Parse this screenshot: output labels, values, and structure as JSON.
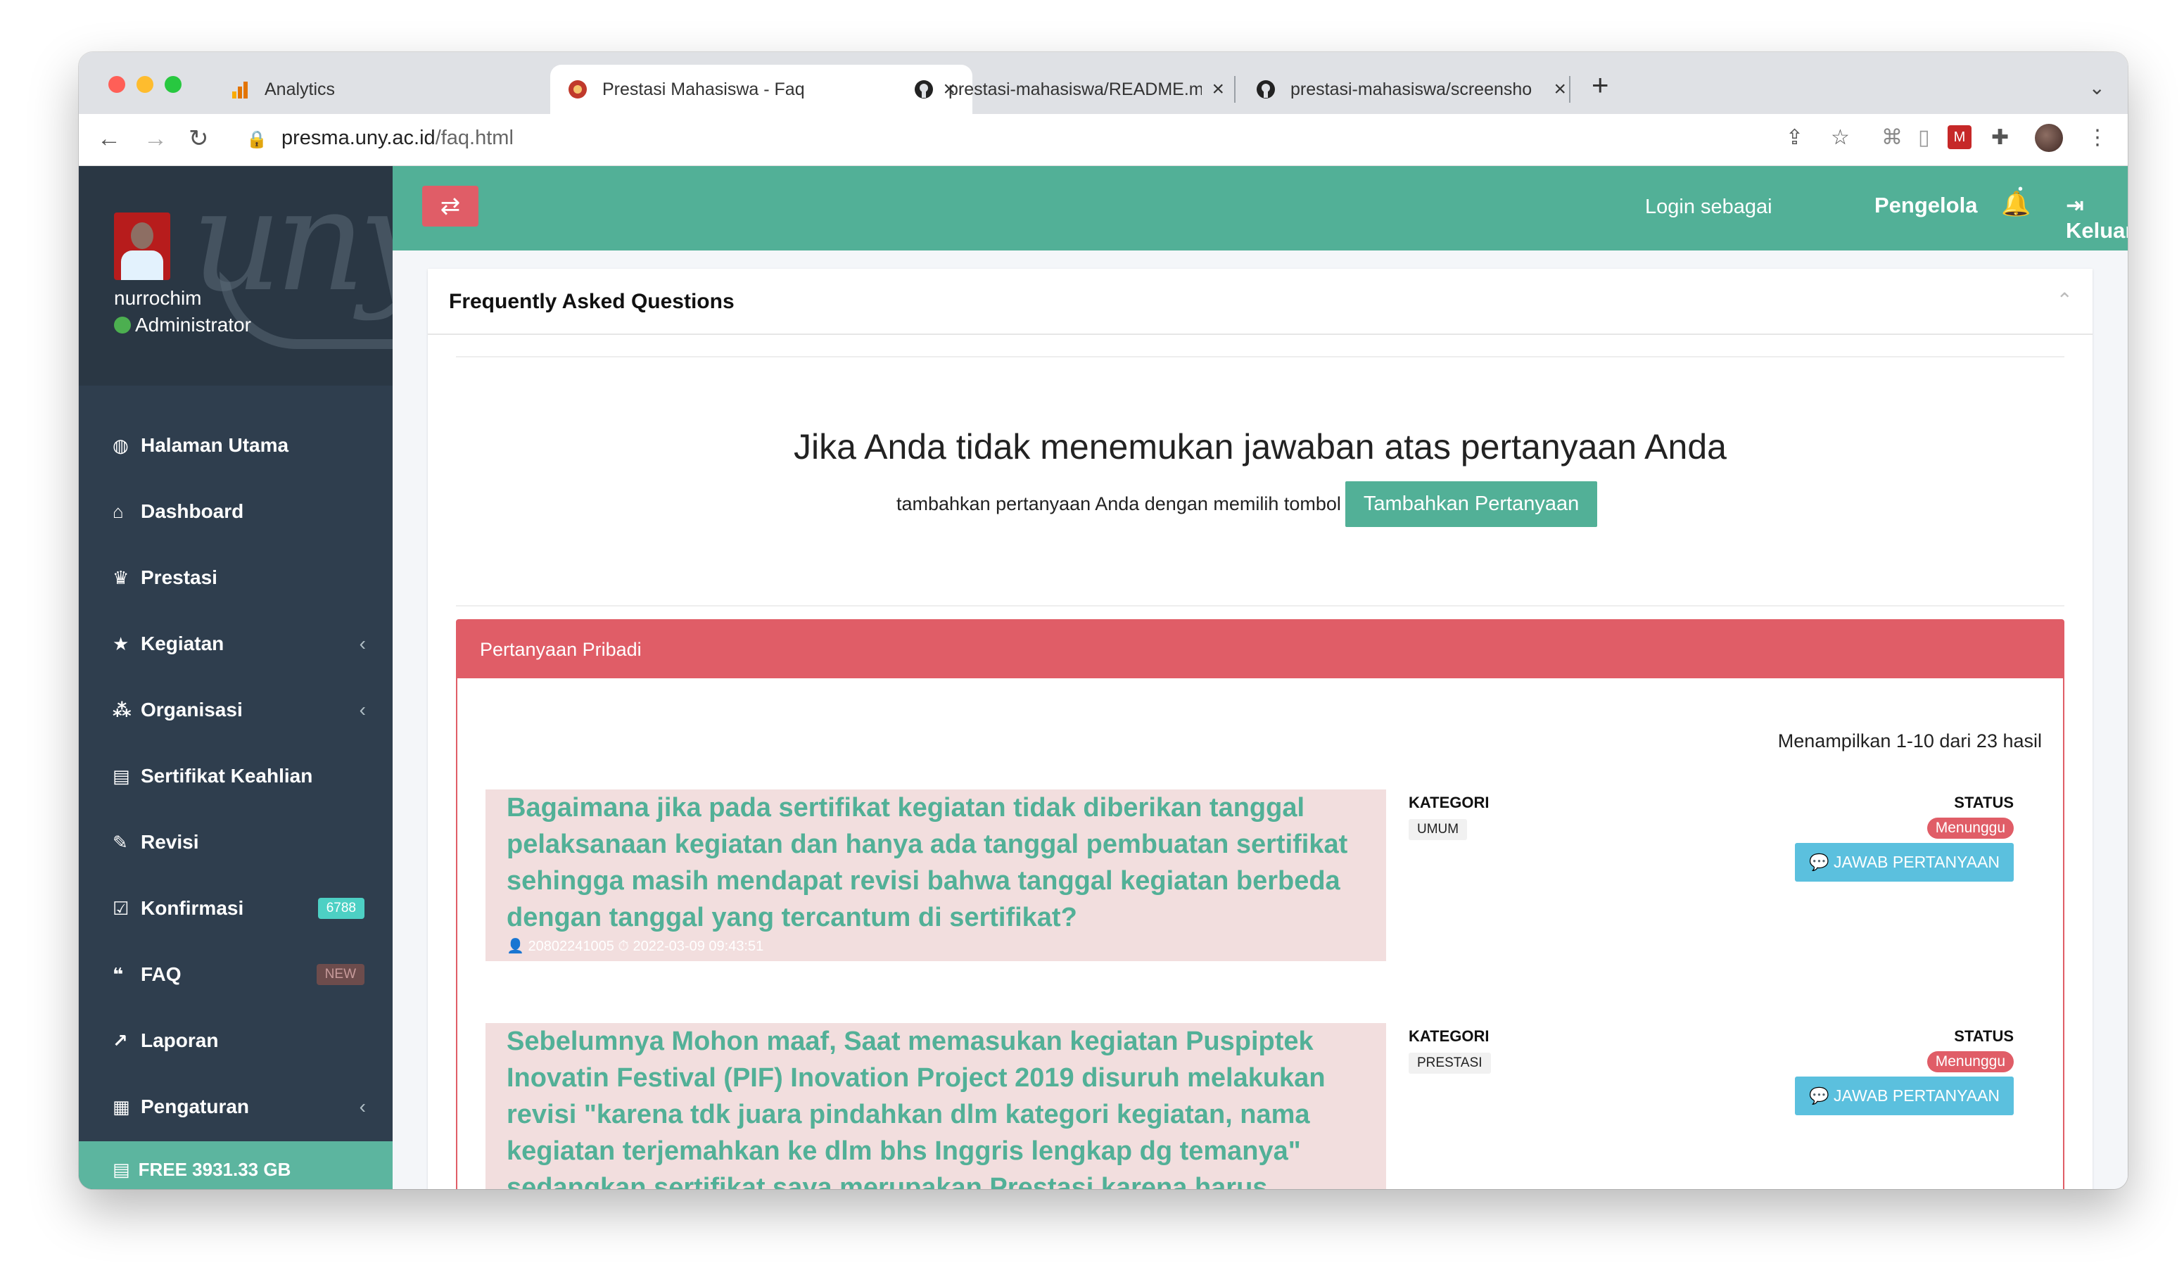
{
  "browser": {
    "tabs": [
      {
        "title": "Analytics",
        "active": false
      },
      {
        "title": "Prestasi Mahasiswa - Faq",
        "active": true
      },
      {
        "title": "prestasi-mahasiswa/README.m",
        "active": false
      },
      {
        "title": "prestasi-mahasiswa/screensho",
        "active": false
      }
    ],
    "url_host": "presma.uny.ac.id",
    "url_path": "/faq.html"
  },
  "sidebar": {
    "user_name": "nurrochim",
    "user_role": "Administrator",
    "menu": [
      {
        "label": "Halaman Utama",
        "icon": "dashboard-icon",
        "glyph": "◍"
      },
      {
        "label": "Dashboard",
        "icon": "home-icon",
        "glyph": "⌂"
      },
      {
        "label": "Prestasi",
        "icon": "trophy-icon",
        "glyph": "♛"
      },
      {
        "label": "Kegiatan",
        "icon": "star-icon",
        "glyph": "★"
      },
      {
        "label": "Organisasi",
        "icon": "sitemap-icon",
        "glyph": "⁂"
      },
      {
        "label": "Sertifikat Keahlian",
        "icon": "certificate-icon",
        "glyph": "▤"
      },
      {
        "label": "Revisi",
        "icon": "edit-icon",
        "glyph": "✎"
      },
      {
        "label": "Konfirmasi",
        "icon": "check-square-icon",
        "glyph": "☑",
        "badge": "6788"
      },
      {
        "label": "FAQ",
        "icon": "comments-icon",
        "glyph": "❝",
        "badge": "NEW"
      },
      {
        "label": "Laporan",
        "icon": "line-chart-icon",
        "glyph": "↗"
      },
      {
        "label": "Pengaturan",
        "icon": "settings-icon",
        "glyph": "▦"
      }
    ],
    "free_space": "FREE 3931.33 GB"
  },
  "topnav": {
    "login_as": "Login sebagai",
    "role": "Pengelola",
    "logout": "Keluar"
  },
  "card": {
    "title": "Frequently Asked Questions",
    "cta_title": "Jika Anda tidak menemukan jawaban atas pertanyaan Anda",
    "cta_text": "tambahkan pertanyaan Anda dengan memilih tombol",
    "cta_button": "Tambahkan Pertanyaan"
  },
  "panel": {
    "title": "Pertanyaan Pribadi",
    "result_count": "Menampilkan 1-10 dari 23 hasil",
    "questions": [
      {
        "text": "Bagaimana jika pada sertifikat kegiatan tidak diberikan tanggal pelaksanaan kegiatan dan hanya ada tanggal pembuatan sertifikat sehingga masih mendapat revisi bahwa tanggal kegiatan berbeda dengan tanggal yang tercantum di sertifikat?",
        "meta": "👤 20802241005 ⏱ 2022-03-09 09:43:51",
        "category_label": "KATEGORI",
        "category": "UMUM",
        "status_label": "STATUS",
        "status": "Menunggu",
        "answer_button": "💬 JAWAB PERTANYAAN"
      },
      {
        "text": "Sebelumnya Mohon maaf, Saat memasukan kegiatan Puspiptek Inovatin Festival (PIF) Inovation Project 2019 disuruh melakukan revisi \"karena tdk juara pindahkan dlm kategori kegiatan, nama kegiatan terjemahkan ke dlm bhs Inggris lengkap dg temanya\" sedangkan sertifikat saya merupakan Prestasi karena harus",
        "meta": "",
        "category_label": "KATEGORI",
        "category": "PRESTASI",
        "status_label": "STATUS",
        "status": "Menunggu",
        "answer_button": "💬 JAWAB PERTANYAAN"
      }
    ]
  },
  "colors": {
    "primary": "#52b097",
    "danger": "#e05d67",
    "info": "#5bc0de",
    "sidebar": "#2f3e4e"
  }
}
